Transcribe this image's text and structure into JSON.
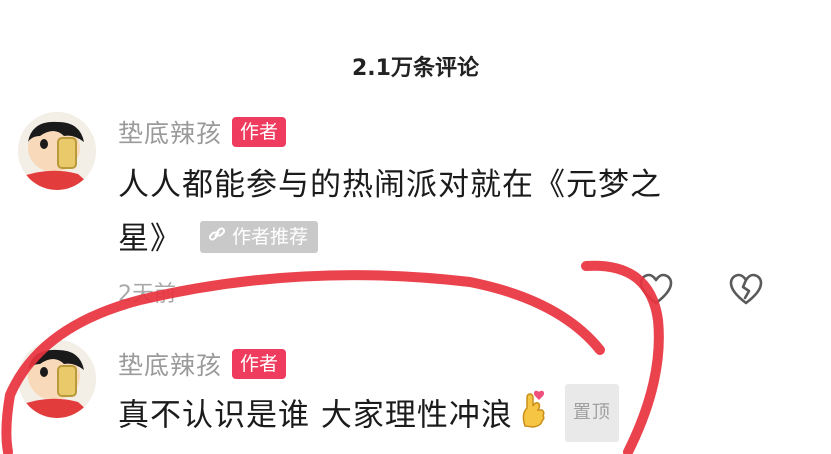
{
  "header": {
    "title": "2.1万条评论"
  },
  "comments": [
    {
      "author": "垫底辣孩",
      "badge": "作者",
      "text_line1": "人人都能参与的热闹派对就在《元梦之",
      "text_line2": "星》",
      "tag": "作者推荐",
      "time": "2天前"
    },
    {
      "author": "垫底辣孩",
      "badge": "作者",
      "text": "真不认识是谁 大家理性冲浪",
      "pin_label": "置顶"
    }
  ],
  "icons": {
    "like": "heart-outline-icon",
    "dislike": "broken-heart-icon",
    "tag_link": "link-icon",
    "emoji": "crossed-fingers-heart-emoji"
  },
  "colors": {
    "badge": "#ef3b5d",
    "annotation": "#e8333f",
    "muted_text": "#9a9a9a"
  }
}
